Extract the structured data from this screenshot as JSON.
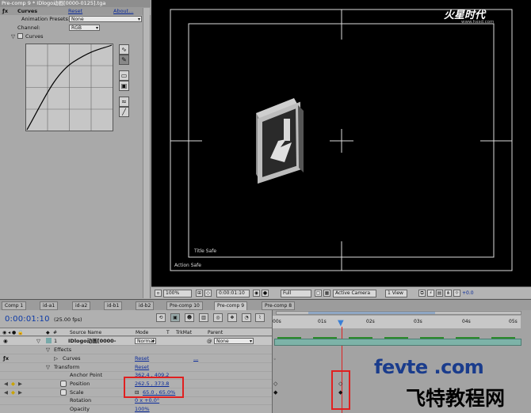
{
  "effect_controls": {
    "title": "Pre-comp 9 * IDlogo动画[0000-0125].tga",
    "effect_name": "Curves",
    "reset": "Reset",
    "about": "About...",
    "presets_label": "Animation Presets:",
    "presets_value": "None",
    "channel_label": "Channel:",
    "channel_value": "RGB",
    "curves_sub": "Curves"
  },
  "viewer": {
    "title_safe": "Title Safe",
    "action_safe": "Action Safe",
    "watermark_logo": "火星时代",
    "watermark_url": "www.hxsd.com",
    "toolbar": {
      "zoom": "100%",
      "timecode": "0:00:01:10",
      "resolution": "Full",
      "camera": "Active Camera",
      "view": "1 View",
      "exposure": "+0.0"
    }
  },
  "tabs": [
    "Comp 1",
    "id-a1",
    "id-a2",
    "id-b1",
    "id-b2",
    "Pre-comp 10",
    "Pre-comp 9",
    "Pre-comp 8"
  ],
  "active_tab_index": 6,
  "timeline": {
    "timecode": "0:00:01:10",
    "fps": "(25.00 fps)",
    "headers": {
      "hash": "#",
      "source": "Source Name",
      "mode": "Mode",
      "t": "T",
      "trkmat": "TrkMat",
      "parent": "Parent"
    },
    "layer": {
      "num": "1",
      "name": "IDlogo动画[0000-",
      "mode": "Normal",
      "parent": "None"
    },
    "effects_label": "Effects",
    "curves_label": "Curves",
    "curves_reset": "Reset",
    "curves_dots": "...",
    "transform_label": "Transform",
    "transform_reset": "Reset",
    "props": [
      {
        "name": "Anchor Point",
        "value": "362.4 , 409.2"
      },
      {
        "name": "Position",
        "value": "262.5 , 373.8"
      },
      {
        "name": "Scale",
        "value": "65.0 , 65.0%"
      },
      {
        "name": "Rotation",
        "value": "0 x +0.0°"
      },
      {
        "name": "Opacity",
        "value": "100%"
      }
    ],
    "ruler_ticks": [
      "00s",
      "01s",
      "02s",
      "03s",
      "04s",
      "05s"
    ]
  },
  "watermark": {
    "line1": "fevte .com",
    "line2": "飞特教程网"
  },
  "colors": {
    "timecode_blue": "#0a38a6",
    "layer_bar": "#7db3a8",
    "highlight_red": "#e02020"
  }
}
